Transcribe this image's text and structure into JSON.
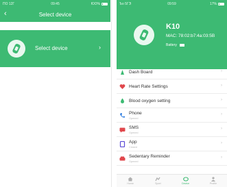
{
  "colors": {
    "accent": "#3dba73",
    "accent_light": "#e9f8ef",
    "text": "#333333",
    "muted": "#b8b8b8"
  },
  "left": {
    "status": {
      "carrier": "ПО 12Г",
      "time": "09:45",
      "battery": "ЮО%"
    },
    "nav": {
      "back_icon": "chevron-left-icon",
      "title": "Select device"
    },
    "card": {
      "label": "Select device",
      "icon": "watch-band-icon"
    }
  },
  "right": {
    "status": {
      "carrier": "Ъо 5ГЭ",
      "time": "09:59",
      "battery": "17%"
    },
    "device": {
      "name": "K10",
      "mac": "MAC: 78:02:b7:4a:03:5B",
      "battery_label": "Battery"
    },
    "menu": [
      {
        "label": "Dash Board",
        "sub": "",
        "icon": "dashboard-icon",
        "color": "#3dba73"
      },
      {
        "label": "Heart Rate Settings",
        "sub": "",
        "icon": "heart-icon",
        "color": "#e0474c"
      },
      {
        "label": "Blood oxygen setting",
        "sub": "",
        "icon": "drop-icon",
        "color": "#3dba73"
      },
      {
        "label": "Phone",
        "sub": "Opened",
        "icon": "phone-icon",
        "color": "#2f7de0"
      },
      {
        "label": "SMS",
        "sub": "Opened",
        "icon": "sms-icon",
        "color": "#e0474c"
      },
      {
        "label": "App",
        "sub": "Closed",
        "icon": "app-icon",
        "color": "#5b4bd6"
      },
      {
        "label": "Sedentary Reminder",
        "sub": "Opened",
        "icon": "sedentary-icon",
        "color": "#e0474c"
      }
    ],
    "tabs": [
      {
        "label": "Home",
        "icon": "home-icon",
        "active": false
      },
      {
        "label": "Sport",
        "icon": "sport-icon",
        "active": false
      },
      {
        "label": "Device",
        "icon": "device-icon",
        "active": true
      },
      {
        "label": "Profile",
        "icon": "profile-icon",
        "active": false
      }
    ]
  }
}
